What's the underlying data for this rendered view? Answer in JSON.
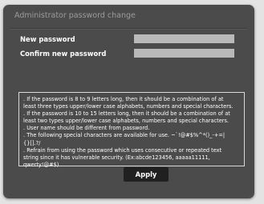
{
  "dialog": {
    "title": "Administrator password change"
  },
  "fields": {
    "new_password": {
      "label": "New password",
      "value": ""
    },
    "confirm_password": {
      "label": "Confirm new password",
      "value": ""
    }
  },
  "rules": {
    "lines": [
      ". If the password is 8 to 9 letters long, then it should be a combination of at",
      "least three types upper/lower case alphabets, numbers and special characters.",
      ". If the password is 10 to 15 letters long, then it should be a combination of at",
      "least two types upper/lower case alphabets, numbers and special characters.",
      ". User name should be different from password.",
      ". The following special characters are available for use. ~`!@#$%^*()_-+=|",
      "{}[].?/",
      ". Refrain from using the password which uses consecutive or repeated text",
      "string since it has vulnerable security. (Ex:abcde123456, aaaaa11111,",
      "qwerty!@#$)"
    ]
  },
  "actions": {
    "apply_label": "Apply"
  },
  "colors": {
    "panel_background": "#4b4b4b",
    "page_background": "#e3e3e3",
    "input_background": "#b9b9b9",
    "button_background": "#202020"
  }
}
